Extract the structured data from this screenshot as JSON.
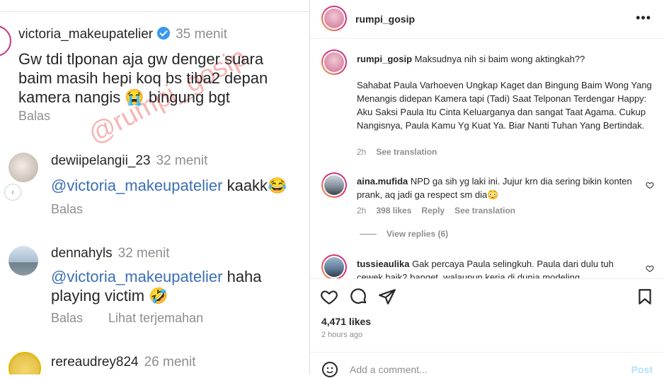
{
  "left": {
    "watermark": "@rumpi_gosip",
    "comments": [
      {
        "user": "victoria_makeupatelier",
        "verified": true,
        "time": "35 menit",
        "text": "Gw tdi tlponan aja gw denger suara baim masih hepi koq bs tiba2 depan kamera nangis 😭 bingung bgt",
        "reply": "Balas"
      },
      {
        "user": "dewiipelangii_23",
        "time": "32 menit",
        "mention": "@victoria_makeupatelier",
        "text": "kaakk😂",
        "reply": "Balas"
      },
      {
        "user": "dennahyls",
        "time": "32 menit",
        "mention": "@victoria_makeupatelier",
        "text": "haha playing victim 🤣",
        "reply": "Balas",
        "translate": "Lihat terjemahan"
      },
      {
        "user": "rereaudrey824",
        "time": "26 menit"
      }
    ]
  },
  "post": {
    "username": "rumpi_gosip",
    "more_icon": "more-dots-icon",
    "caption_user": "rumpi_gosip",
    "caption_first": "Maksudnya nih si baim wong aktingkah??",
    "caption_body": "Sahabat Paula Varhoeven Ungkap Kaget dan Bingung Baim Wong Yang Menangis didepan Kamera tapi (Tadi) Saat Telponan Terdengar Happy: Aku Saksi Paula Itu Cinta Keluarganya dan sangat Taat Agama. Cukup Nangisnya, Paula Kamu Yg Kuat Ya. Biar Nanti Tuhan Yang Bertindak.",
    "caption_time": "2h",
    "caption_translate": "See translation",
    "comments": [
      {
        "user": "aina.mufida",
        "text": "NPD ga sih yg laki ini. Jujur krn dia sering bikin konten prank, aq jadi ga respect sm dia😳",
        "time": "2h",
        "likes": "398 likes",
        "reply": "Reply",
        "translate": "See translation"
      },
      {
        "user": "tussieaulika",
        "text": "Gak percaya Paula selingkuh. Paula dari dulu tuh cewek baik2 banget, walaupun kerja di dunia modeling"
      }
    ],
    "view_replies": "View replies (6)",
    "likes": "4,471 likes",
    "ago": "2 hours ago",
    "add_comment_placeholder": "Add a comment...",
    "post_label": "Post"
  }
}
